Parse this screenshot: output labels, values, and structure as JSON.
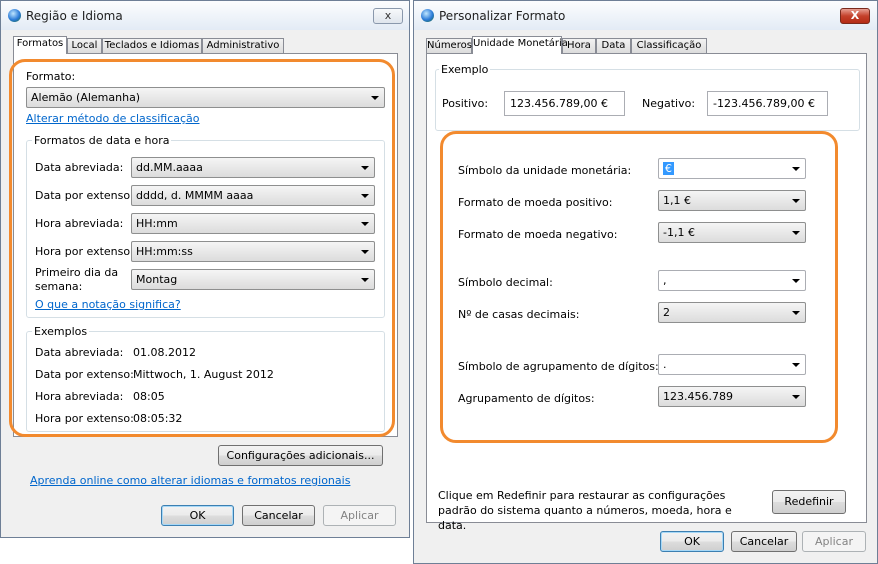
{
  "left_window": {
    "title": "Região e Idioma",
    "close_label": "x",
    "tabs": [
      "Formatos",
      "Local",
      "Teclados e Idiomas",
      "Administrativo"
    ],
    "format": {
      "label": "Formato:",
      "value": "Alemão (Alemanha)"
    },
    "change_sort_link": "Alterar método de classificação",
    "datetime_group": {
      "legend": "Formatos de data e hora",
      "short_date_label": "Data abreviada:",
      "short_date_value": "dd.MM.aaaa",
      "long_date_label": "Data por extenso:",
      "long_date_value": "dddd, d. MMMM aaaa",
      "short_time_label": "Hora abreviada:",
      "short_time_value": "HH:mm",
      "long_time_label": "Hora por extenso:",
      "long_time_value": "HH:mm:ss",
      "first_day_label": "Primeiro dia da semana:",
      "first_day_value": "Montag",
      "notation_link": "O que a notação significa?"
    },
    "examples": {
      "legend": "Exemplos",
      "short_date_label": "Data abreviada:",
      "short_date_value": "01.08.2012",
      "long_date_label": "Data por extenso:",
      "long_date_value": "Mittwoch, 1. August 2012",
      "short_time_label": "Hora abreviada:",
      "short_time_value": "08:05",
      "long_time_label": "Hora por extenso:",
      "long_time_value": "08:05:32"
    },
    "additional_settings_button": "Configurações adicionais...",
    "learn_link": "Aprenda online como alterar idiomas e formatos regionais",
    "ok_button": "OK",
    "cancel_button": "Cancelar",
    "apply_button": "Aplicar"
  },
  "right_window": {
    "title": "Personalizar Formato",
    "close_label": "X",
    "tabs": [
      "Números",
      "Unidade Monetária",
      "Hora",
      "Data",
      "Classificação"
    ],
    "example": {
      "legend": "Exemplo",
      "positive_label": "Positivo:",
      "positive_value": "123.456.789,00 €",
      "negative_label": "Negativo:",
      "negative_value": "-123.456.789,00 €"
    },
    "settings": {
      "currency_symbol_label": "Símbolo da unidade monetária:",
      "currency_symbol_value": "€",
      "positive_format_label": "Formato de moeda positivo:",
      "positive_format_value": "1,1 €",
      "negative_format_label": "Formato de moeda negativo:",
      "negative_format_value": "-1,1 €",
      "decimal_symbol_label": "Símbolo decimal:",
      "decimal_symbol_value": ",",
      "decimal_places_label": "Nº de casas decimais:",
      "decimal_places_value": "2",
      "grouping_symbol_label": "Símbolo de agrupamento de dígitos:",
      "grouping_symbol_value": ".",
      "grouping_label": "Agrupamento de dígitos:",
      "grouping_value": "123.456.789"
    },
    "reset_note": "Clique em Redefinir para restaurar as configurações padrão do sistema quanto a números, moeda, hora e data.",
    "reset_button": "Redefinir",
    "ok_button": "OK",
    "cancel_button": "Cancelar",
    "apply_button": "Aplicar"
  },
  "colors": {
    "highlight": "#f28a2e",
    "link": "#0066cc",
    "selection": "#3399ff"
  }
}
